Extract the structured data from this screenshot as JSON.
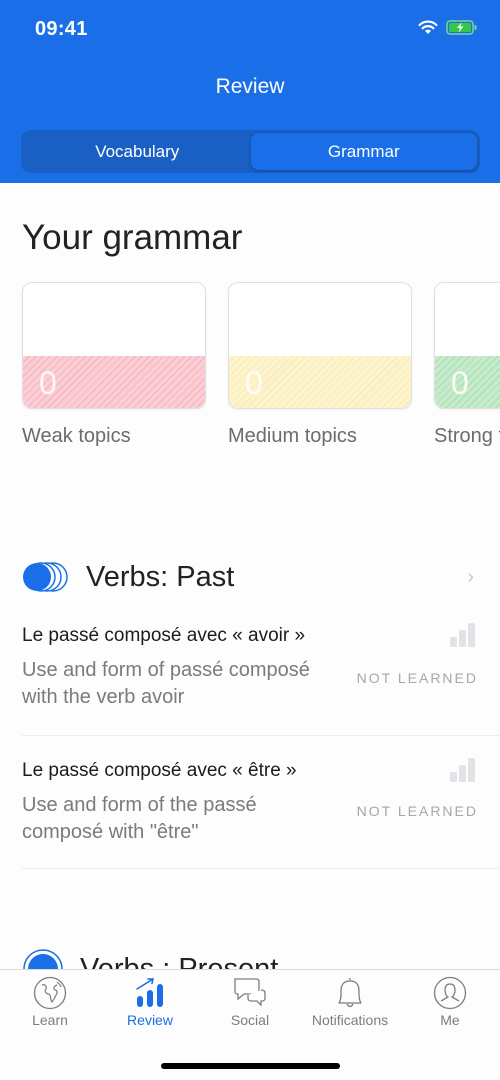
{
  "status_bar": {
    "time": "09:41",
    "wifi_icon": "wifi-icon",
    "battery_icon": "battery-charging-icon"
  },
  "header": {
    "title": "Review"
  },
  "segments": [
    {
      "label": "Vocabulary",
      "active": false
    },
    {
      "label": "Grammar",
      "active": true
    }
  ],
  "section_title": "Your grammar",
  "strength_cards": [
    {
      "label": "Weak topics",
      "count": "0",
      "color": "#f9c4ce"
    },
    {
      "label": "Medium topics",
      "count": "0",
      "color": "#fdf2c7"
    },
    {
      "label": "Strong topics",
      "count": "0",
      "color": "#c3e9c8"
    }
  ],
  "topics": [
    {
      "name": "Verbs: Past",
      "icon": "progress-circles-icon",
      "lessons": [
        {
          "title": "Le passé composé avec « avoir »",
          "description": "Use and form of passé composé with the verb avoir",
          "status": "NOT LEARNED"
        },
        {
          "title": "Le passé composé avec « être »",
          "description": "Use and form of the passé composé with \"être\"",
          "status": "NOT LEARNED"
        }
      ]
    },
    {
      "name": "Verbs : Present",
      "icon": "progress-circle-icon",
      "lessons": []
    }
  ],
  "tabbar": [
    {
      "label": "Learn",
      "icon": "globe-icon",
      "active": false
    },
    {
      "label": "Review",
      "icon": "chart-up-icon",
      "active": true
    },
    {
      "label": "Social",
      "icon": "chat-bubbles-icon",
      "active": false
    },
    {
      "label": "Notifications",
      "icon": "bell-icon",
      "active": false
    },
    {
      "label": "Me",
      "icon": "user-icon",
      "active": false
    }
  ],
  "colors": {
    "accent": "#1a6fe8",
    "segment_bg": "#1a5fc4"
  }
}
